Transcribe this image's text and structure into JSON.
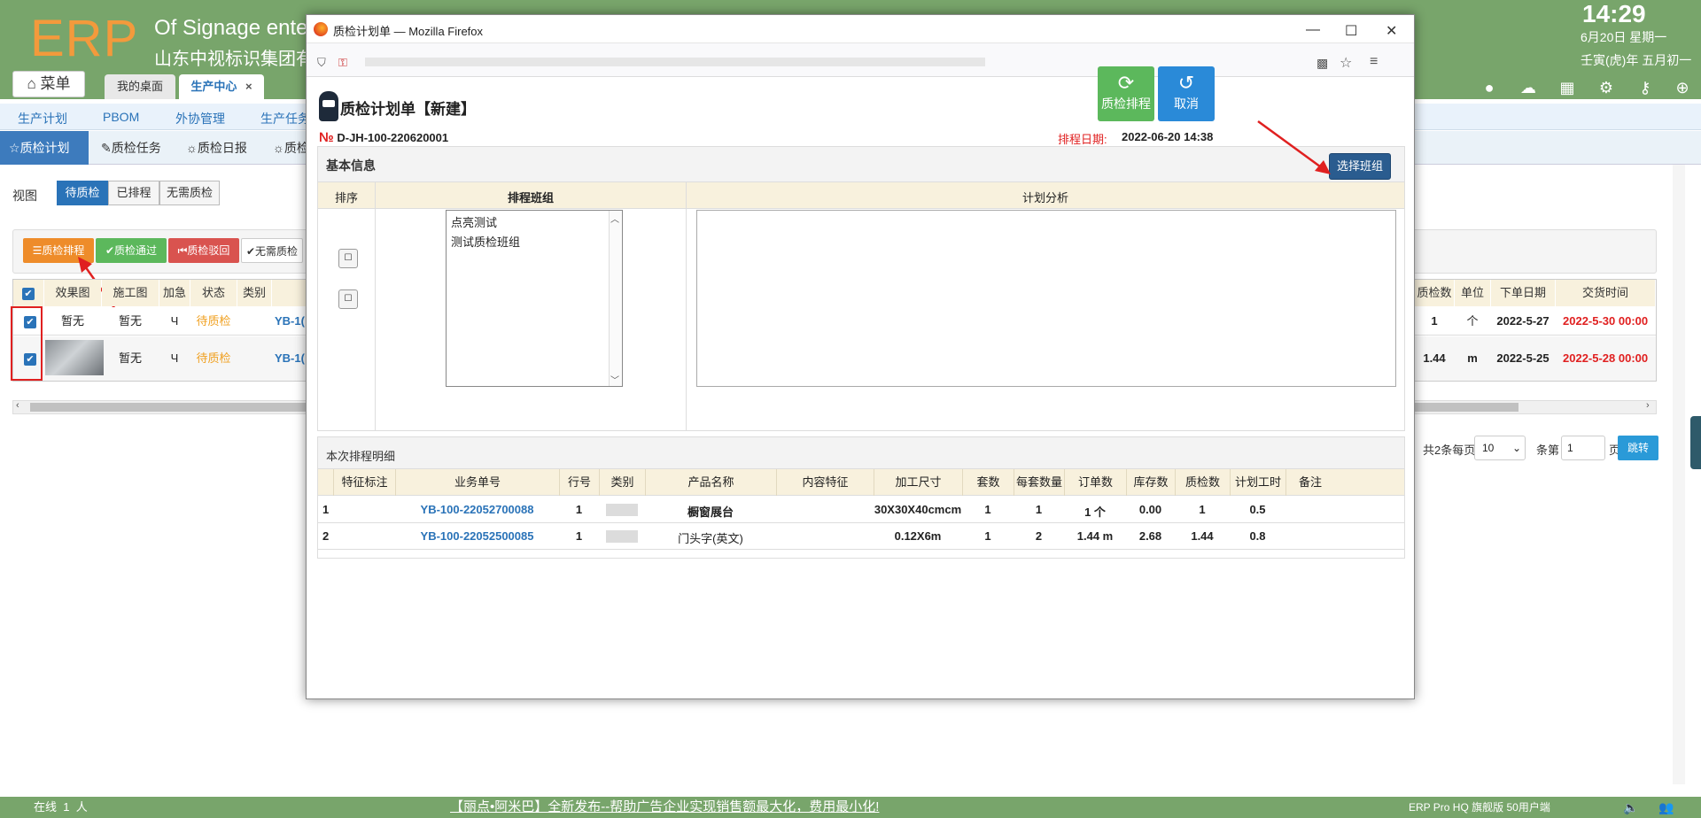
{
  "header": {
    "logo": "ERP",
    "company_en": "Of Signage ente",
    "company_cn": "山东中视标识集团有",
    "time": "14:29",
    "date_line": "6月20日 星期一",
    "lunar_line": "壬寅(虎)年 五月初一",
    "menu_label": "菜单",
    "tabs": [
      {
        "label": "我的桌面"
      },
      {
        "label": "生产中心",
        "close": "×"
      }
    ]
  },
  "nav2": [
    "生产计划",
    "PBOM",
    "外协管理",
    "生产任务"
  ],
  "nav3": [
    "质检计划",
    "质检任务",
    "质检日报",
    "质检"
  ],
  "view": {
    "label": "视图",
    "segments": [
      "待质检",
      "已排程",
      "无需质检"
    ]
  },
  "toolbar": [
    "质检排程",
    "质检通过",
    "质检驳回",
    "无需质检"
  ],
  "grid": {
    "headers_left": [
      "效果图",
      "施工图",
      "加急",
      "状态",
      "类别"
    ],
    "headers_right": [
      "质检数",
      "单位",
      "下单日期",
      "交货时间"
    ],
    "rows": [
      {
        "effect": "暂无",
        "construct": "暂无",
        "urgent": "Ч",
        "status": "待质检",
        "order": "YB-1(",
        "qc": "1",
        "unit": "个",
        "order_date": "2022-5-27",
        "delivery": "2022-5-30 00:00"
      },
      {
        "effect": "",
        "construct": "暂无",
        "urgent": "Ч",
        "status": "待质检",
        "order": "YB-1(",
        "qc": "1.44",
        "unit": "m",
        "order_date": "2022-5-25",
        "delivery": "2022-5-28 00:00"
      }
    ]
  },
  "pager": {
    "prefix": "共2条每页",
    "size": "10",
    "mid": "条第",
    "page": "1",
    "suffix": "页",
    "jump": "跳转"
  },
  "footer": {
    "online_label": "在线",
    "online_count": "1",
    "online_unit": "人",
    "marquee": "【丽点•阿米巴】全新发布--帮助广告企业实现销售额最大化，费用最小化!",
    "edition": "ERP Pro HQ 旗舰版 50用户端"
  },
  "popup": {
    "window_title": "质检计划单 — Mozilla Firefox",
    "form_title": "质检计划单【新建】",
    "doc_no_prefix": "№",
    "doc_no": "D-JH-100-220620001",
    "schedule_date_label": "排程日期:",
    "schedule_date": "2022-06-20 14:38",
    "btn_schedule": "质检排程",
    "btn_cancel": "取消",
    "basic_info": "基本信息",
    "btn_select_team": "选择班组",
    "col_order": "排序",
    "col_team": "排程班组",
    "col_analysis": "计划分析",
    "teams": [
      "点亮测试",
      "测试质检班组"
    ],
    "detail_title": "本次排程明细",
    "detail_headers": [
      "特征标注",
      "业务单号",
      "行号",
      "类别",
      "产品名称",
      "内容特征",
      "加工尺寸",
      "套数",
      "每套数量",
      "订单数",
      "库存数",
      "质检数",
      "计划工时",
      "备注"
    ],
    "detail_rows": [
      {
        "n": "1",
        "feat": "",
        "order": "YB-100-22052700088",
        "line": "1",
        "cat": "",
        "name": "橱窗展台",
        "content": "",
        "size": "30X30X40cmcm",
        "sets": "1",
        "per": "1",
        "qty": "1 个",
        "stock": "0.00",
        "qc": "1",
        "hours": "0.5",
        "note": ""
      },
      {
        "n": "2",
        "feat": "",
        "order": "YB-100-22052500085",
        "line": "1",
        "cat": "",
        "name": "门头字(英文)",
        "content": "",
        "size": "0.12X6m",
        "sets": "1",
        "per": "2",
        "qty": "1.44 m",
        "stock": "2.68",
        "qc": "1.44",
        "hours": "0.8",
        "note": ""
      }
    ]
  },
  "colors": {
    "header_green": "#78a56b",
    "accent_blue": "#2a73b8",
    "orange": "#f39a3c",
    "green_btn": "#5cb85c",
    "red": "#e02020"
  }
}
